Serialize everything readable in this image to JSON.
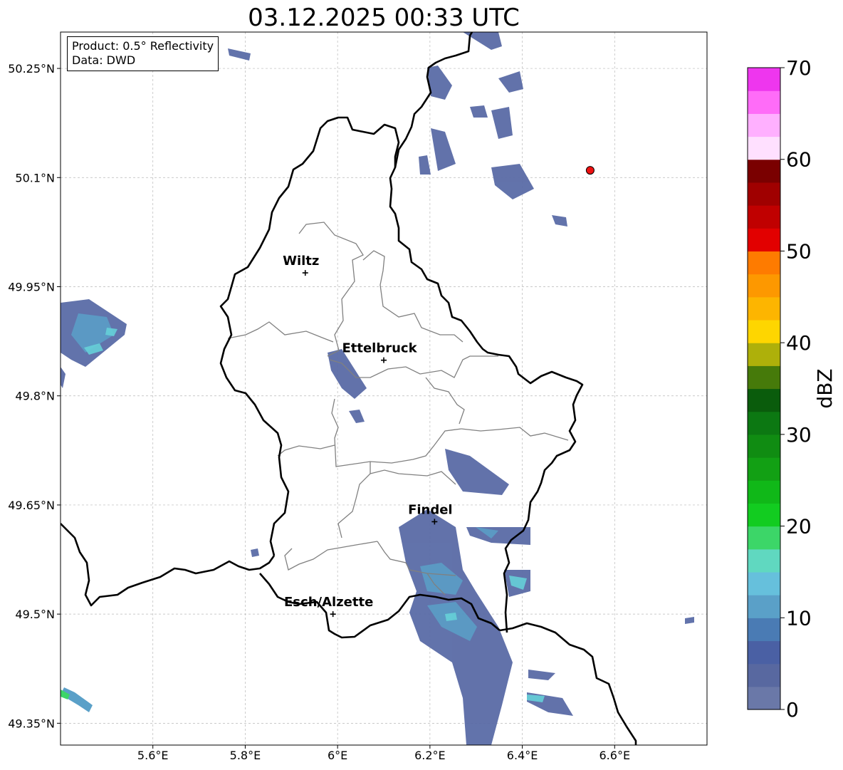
{
  "title": "03.12.2025 00:33 UTC",
  "info": {
    "product": "Product: 0.5° Reflectivity",
    "data": "Data: DWD"
  },
  "axes": {
    "lon_range": [
      5.4,
      6.8
    ],
    "lat_range": [
      49.32,
      50.3
    ],
    "x_ticks": [
      {
        "v": 5.6,
        "label": "5.6°E"
      },
      {
        "v": 5.8,
        "label": "5.8°E"
      },
      {
        "v": 6.0,
        "label": "6°E"
      },
      {
        "v": 6.2,
        "label": "6.2°E"
      },
      {
        "v": 6.4,
        "label": "6.4°E"
      },
      {
        "v": 6.6,
        "label": "6.6°E"
      }
    ],
    "y_ticks": [
      {
        "v": 49.35,
        "label": "49.35°N"
      },
      {
        "v": 49.5,
        "label": "49.5°N"
      },
      {
        "v": 49.65,
        "label": "49.65°N"
      },
      {
        "v": 49.8,
        "label": "49.8°N"
      },
      {
        "v": 49.95,
        "label": "49.95°N"
      },
      {
        "v": 50.1,
        "label": "50.1°N"
      },
      {
        "v": 50.25,
        "label": "50.25°N"
      }
    ],
    "grid": true
  },
  "cities": [
    {
      "name": "Wiltz",
      "lon": 5.93,
      "lat": 49.969
    },
    {
      "name": "Ettelbruck",
      "lon": 6.1,
      "lat": 49.849
    },
    {
      "name": "Findel",
      "lon": 6.21,
      "lat": 49.627
    },
    {
      "name": "Esch/Alzette",
      "lon": 5.99,
      "lat": 49.5
    }
  ],
  "radar_site": {
    "lon": 6.547,
    "lat": 50.11,
    "color": "#ee1111"
  },
  "colorbar": {
    "label": "dBZ",
    "min": 0,
    "max": 70,
    "ticks": [
      0,
      10,
      20,
      30,
      40,
      50,
      60,
      70
    ],
    "colors": [
      "#6a78a8",
      "#5868a0",
      "#4a60a4",
      "#4a7bb4",
      "#5aa0c8",
      "#66c0dc",
      "#60d8c0",
      "#3cd668",
      "#12cc20",
      "#10b818",
      "#12a014",
      "#108c12",
      "#0c7812",
      "#0a5c0c",
      "#467a0a",
      "#aeb00a",
      "#fed600",
      "#fdb500",
      "#fd9800",
      "#fe7b00",
      "#e20000",
      "#c00000",
      "#a00000",
      "#7a0000",
      "#ffe0ff",
      "#ffb0ff",
      "#ff6cf8",
      "#ee36ee"
    ]
  }
}
